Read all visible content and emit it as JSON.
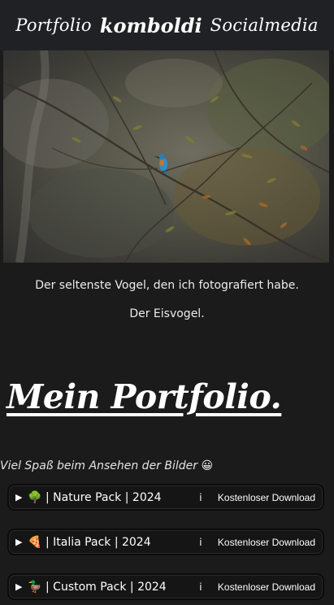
{
  "nav": {
    "left_link": "Portfolio",
    "brand": "komboldi",
    "right_link": "Socialmedia"
  },
  "hero": {
    "caption_line1": "Der seltenste Vogel, den ich fotografiert habe.",
    "caption_line2": "Der Eisvogel."
  },
  "portfolio": {
    "heading": "Mein Portfolio.",
    "intro": "Viel Spaß beim Ansehen der Bilder 😀",
    "packs": [
      {
        "arrow": "▶",
        "emoji": "🌳",
        "title": "| Nature Pack | 2024",
        "info": "i",
        "download": "Kostenloser Download"
      },
      {
        "arrow": "▶",
        "emoji": "🍕",
        "title": "| Italia Pack | 2024",
        "info": "i",
        "download": "Kostenloser Download"
      },
      {
        "arrow": "▶",
        "emoji": "🦆",
        "title": "| Custom Pack | 2024",
        "info": "i",
        "download": "Kostenloser Download"
      }
    ]
  },
  "colors": {
    "background": "#1b1b1b",
    "nav_background": "#202124",
    "text": "#ffffff",
    "kingfisher_blue": "#2f8fc8",
    "kingfisher_orange": "#c9742e"
  }
}
